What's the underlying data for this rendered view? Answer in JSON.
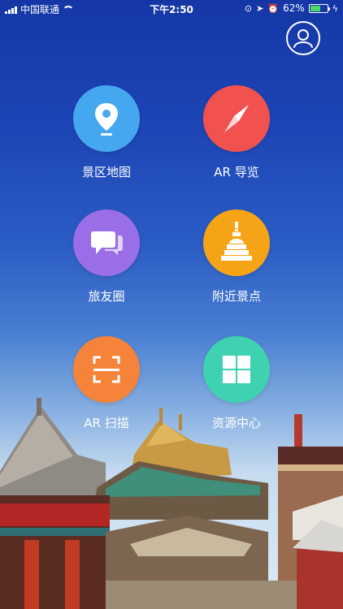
{
  "status_bar": {
    "carrier": "中国联通",
    "time": "下午2:50",
    "battery": "62%",
    "battery_level": 0.62
  },
  "profile": {
    "icon": "user-icon"
  },
  "menu": [
    {
      "label": "景区地图",
      "icon": "map-pin-icon",
      "color": "#45a7f0"
    },
    {
      "label": "AR 导览",
      "icon": "compass-icon",
      "color": "#f2524f"
    },
    {
      "label": "旅友圈",
      "icon": "chat-bubbles-icon",
      "color": "#9a6ee6"
    },
    {
      "label": "附近景点",
      "icon": "stupa-icon",
      "color": "#f6a417"
    },
    {
      "label": "AR 扫描",
      "icon": "scan-icon",
      "color": "#f5833a"
    },
    {
      "label": "资源中心",
      "icon": "grid-icon",
      "color": "#3fd2b0"
    }
  ]
}
